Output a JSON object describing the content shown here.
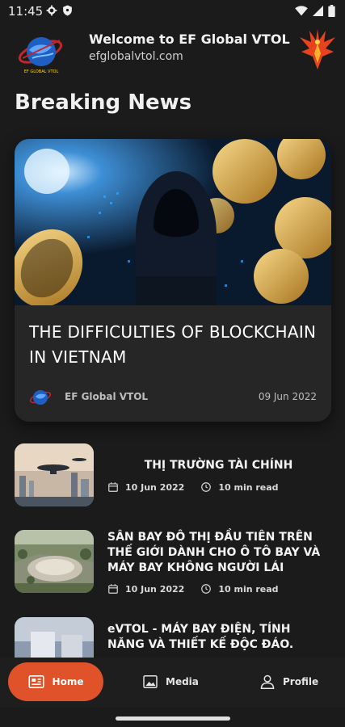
{
  "status": {
    "time": "11:45"
  },
  "header": {
    "title": "Welcome to EF Global VTOL",
    "subtitle": "efglobalvtol.com",
    "logo_text": "EF GLOBAL VTOL"
  },
  "section_title": "Breaking News",
  "featured": {
    "headline": "THE DIFFICULTIES OF BLOCKCHAIN IN VIETNAM",
    "author": "EF Global VTOL",
    "date": "09 Jun 2022"
  },
  "news": [
    {
      "title": "THỊ TRƯỜNG TÀI CHÍNH",
      "date": "10 Jun 2022",
      "read_time": "10 min read"
    },
    {
      "title": "SÂN BAY ĐÔ THỊ ĐẦU TIÊN TRÊN THẾ GIỚI DÀNH CHO Ô TÔ BAY VÀ MÁY BAY KHÔNG NGƯỜI LÁI",
      "date": "10 Jun 2022",
      "read_time": "10 min read"
    },
    {
      "title": "eVTOL - MÁY BAY ĐIỆN, TÍNH NĂNG VÀ THIẾT KẾ ĐỘC ĐÁO."
    }
  ],
  "nav": {
    "home": "Home",
    "media": "Media",
    "profile": "Profile"
  },
  "colors": {
    "accent": "#e0522a",
    "background": "#1b1b1b",
    "card": "#262626"
  }
}
